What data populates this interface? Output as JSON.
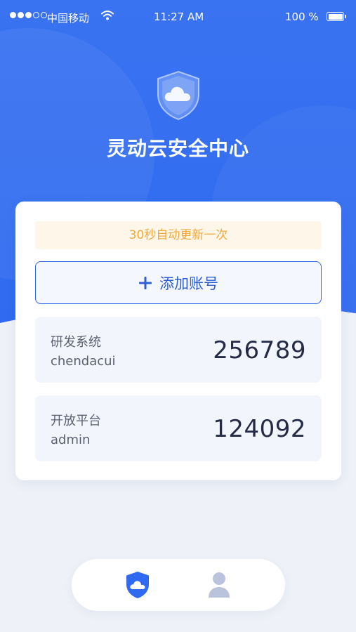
{
  "status_bar": {
    "carrier": "中国移动",
    "time": "11:27 AM",
    "battery": "100 %",
    "signal_bars_filled": 3,
    "signal_bars_total": 5
  },
  "header": {
    "title": "灵动云安全中心",
    "logo_icon": "cloud-shield-icon"
  },
  "card": {
    "notice": "30秒自动更新一次",
    "add_button_label": "添加账号",
    "accounts": [
      {
        "system": "研发系统",
        "user": "chendacui",
        "code": "256789"
      },
      {
        "system": "开放平台",
        "user": "admin",
        "code": "124092"
      }
    ]
  },
  "tab_bar": {
    "tabs": [
      {
        "icon": "cloud-shield-icon",
        "active": true
      },
      {
        "icon": "user-icon",
        "active": false
      }
    ]
  },
  "colors": {
    "primary": "#2f6af0",
    "notice_text": "#f2a93b",
    "notice_bg": "#fef6e8",
    "code_text": "#252b47",
    "inactive_icon": "#b9c4dc"
  }
}
